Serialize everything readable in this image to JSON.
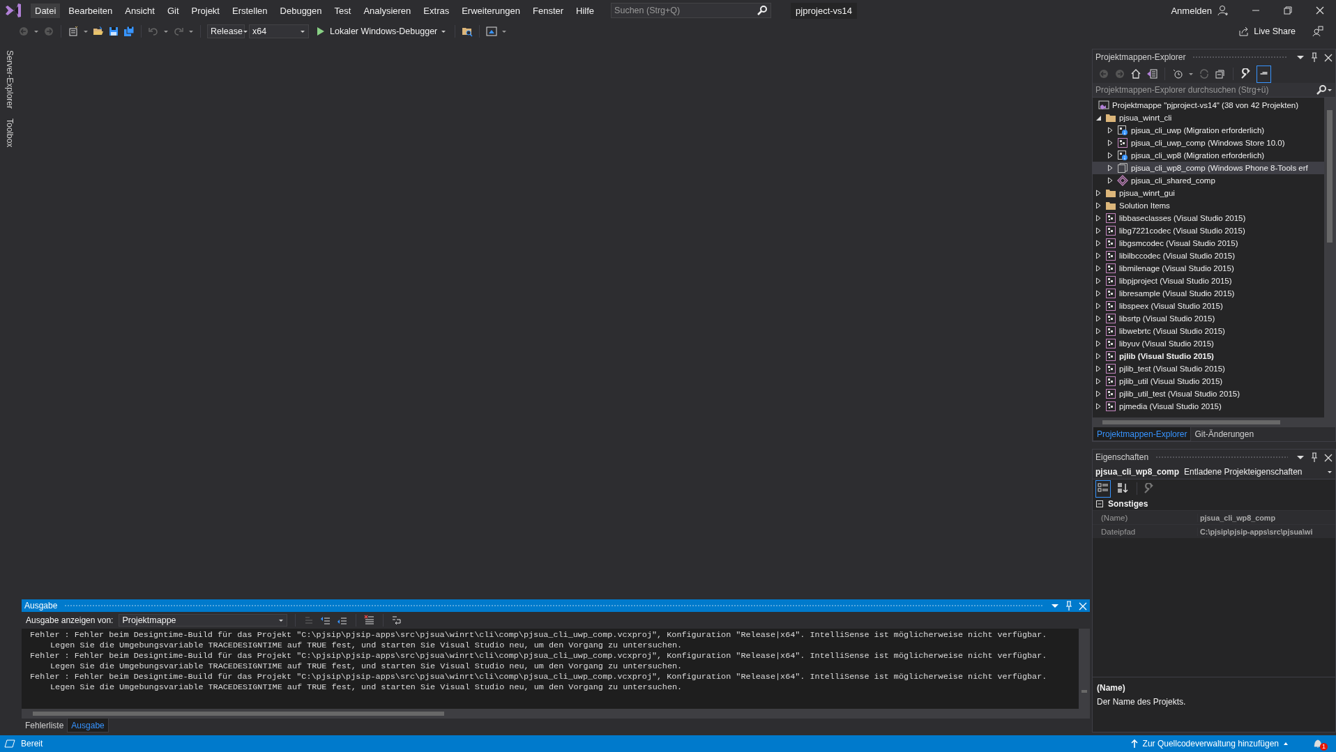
{
  "menu": [
    {
      "label": "Datei",
      "selected": true
    },
    {
      "label": "Bearbeiten",
      "selected": false
    },
    {
      "label": "Ansicht",
      "selected": false
    },
    {
      "label": "Git",
      "selected": false
    },
    {
      "label": "Projekt",
      "selected": false
    },
    {
      "label": "Erstellen",
      "selected": false
    },
    {
      "label": "Debuggen",
      "selected": false
    },
    {
      "label": "Test",
      "selected": false
    },
    {
      "label": "Analysieren",
      "selected": false
    },
    {
      "label": "Extras",
      "selected": false
    },
    {
      "label": "Erweiterungen",
      "selected": false
    },
    {
      "label": "Fenster",
      "selected": false
    },
    {
      "label": "Hilfe",
      "selected": false
    }
  ],
  "search": {
    "placeholder": "Suchen (Strg+Q)"
  },
  "solution_name": "pjproject-vs14",
  "account": "Anmelden",
  "toolbar": {
    "configuration": "Release",
    "platform": "x64",
    "debugger": "Lokaler Windows-Debugger",
    "live_share": "Live Share"
  },
  "side_tabs": [
    "Server-Explorer",
    "Toolbox"
  ],
  "solution_explorer": {
    "title": "Projektmappen-Explorer",
    "preview_selected": true,
    "search": {
      "placeholder": "Projektmappen-Explorer durchsuchen (Strg+ü)"
    },
    "tree": [
      {
        "label": "Projektmappe \"pjproject-vs14\" (38 von 42 Projekten)",
        "kind": "solution",
        "selected": false,
        "startup": false,
        "children": [
          {
            "label": "pjsua_winrt_cli",
            "kind": "folder",
            "expanded": true,
            "selected": false,
            "startup": false,
            "children": [
              {
                "label": "pjsua_cli_uwp (Migration erforderlich)",
                "kind": "migration",
                "expanded": false,
                "selected": false,
                "startup": false
              },
              {
                "label": "pjsua_cli_uwp_comp (Windows Store 10.0)",
                "kind": "project",
                "expanded": false,
                "selected": false,
                "startup": false
              },
              {
                "label": "pjsua_cli_wp8 (Migration erforderlich)",
                "kind": "migration",
                "expanded": false,
                "selected": false,
                "startup": false
              },
              {
                "label": "pjsua_cli_wp8_comp (Windows Phone 8-Tools erf",
                "kind": "unloaded",
                "expanded": false,
                "selected": true,
                "startup": false
              },
              {
                "label": "pjsua_cli_shared_comp",
                "kind": "shared",
                "expanded": false,
                "selected": false,
                "startup": false
              }
            ]
          },
          {
            "label": "pjsua_winrt_gui",
            "kind": "folder",
            "expanded": false,
            "selected": false,
            "startup": false
          },
          {
            "label": "Solution Items",
            "kind": "folder",
            "expanded": false,
            "selected": false,
            "startup": false
          },
          {
            "label": "libbaseclasses (Visual Studio 2015)",
            "kind": "project",
            "expanded": false,
            "selected": false,
            "startup": false
          },
          {
            "label": "libg7221codec (Visual Studio 2015)",
            "kind": "project",
            "expanded": false,
            "selected": false,
            "startup": false
          },
          {
            "label": "libgsmcodec (Visual Studio 2015)",
            "kind": "project",
            "expanded": false,
            "selected": false,
            "startup": false
          },
          {
            "label": "libilbccodec (Visual Studio 2015)",
            "kind": "project",
            "expanded": false,
            "selected": false,
            "startup": false
          },
          {
            "label": "libmilenage (Visual Studio 2015)",
            "kind": "project",
            "expanded": false,
            "selected": false,
            "startup": false
          },
          {
            "label": "libpjproject (Visual Studio 2015)",
            "kind": "project",
            "expanded": false,
            "selected": false,
            "startup": false
          },
          {
            "label": "libresample (Visual Studio 2015)",
            "kind": "project",
            "expanded": false,
            "selected": false,
            "startup": false
          },
          {
            "label": "libspeex (Visual Studio 2015)",
            "kind": "project",
            "expanded": false,
            "selected": false,
            "startup": false
          },
          {
            "label": "libsrtp (Visual Studio 2015)",
            "kind": "project",
            "expanded": false,
            "selected": false,
            "startup": false
          },
          {
            "label": "libwebrtc (Visual Studio 2015)",
            "kind": "project",
            "expanded": false,
            "selected": false,
            "startup": false
          },
          {
            "label": "libyuv (Visual Studio 2015)",
            "kind": "project",
            "expanded": false,
            "selected": false,
            "startup": false
          },
          {
            "label": "pjlib (Visual Studio 2015)",
            "kind": "project",
            "expanded": false,
            "selected": false,
            "startup": true
          },
          {
            "label": "pjlib_test (Visual Studio 2015)",
            "kind": "project",
            "expanded": false,
            "selected": false,
            "startup": false
          },
          {
            "label": "pjlib_util (Visual Studio 2015)",
            "kind": "project",
            "expanded": false,
            "selected": false,
            "startup": false
          },
          {
            "label": "pjlib_util_test (Visual Studio 2015)",
            "kind": "project",
            "expanded": false,
            "selected": false,
            "startup": false
          },
          {
            "label": "pjmedia (Visual Studio 2015)",
            "kind": "project",
            "expanded": false,
            "selected": false,
            "startup": false
          }
        ]
      }
    ],
    "tabs": [
      {
        "label": "Projektmappen-Explorer",
        "selected": true
      },
      {
        "label": "Git-Änderungen",
        "selected": false
      }
    ]
  },
  "properties": {
    "title": "Eigenschaften",
    "object_name": "pjsua_cli_wp8_comp",
    "object_type": "Entladene Projekteigenschaften",
    "view_buttons": [
      {
        "kind": "categorized",
        "selected": true
      },
      {
        "kind": "alphabetical",
        "selected": false
      }
    ],
    "category": {
      "label": "Sonstiges",
      "expanded": true
    },
    "rows": [
      {
        "name": "(Name)",
        "value": "pjsua_cli_wp8_comp"
      },
      {
        "name": "Dateipfad",
        "value": "C:\\pjsip\\pjsip-apps\\src\\pjsua\\wi"
      }
    ],
    "description": {
      "title": "(Name)",
      "text": "Der Name des Projekts."
    }
  },
  "output": {
    "title": "Ausgabe",
    "source_label": "Ausgabe anzeigen von:",
    "source": "Projektmappe",
    "lines": [
      {
        "kind": "error",
        "text": "Fehler : Fehler beim Designtime-Build für das Projekt \"C:\\pjsip\\pjsip-apps\\src\\pjsua\\winrt\\cli\\comp\\pjsua_cli_uwp_comp.vcxproj\", Konfiguration \"Release|x64\". IntelliSense ist möglicherweise nicht verfügbar."
      },
      {
        "kind": "detail",
        "text": "Legen Sie die Umgebungsvariable TRACEDESIGNTIME auf TRUE fest, und starten Sie Visual Studio neu, um den Vorgang zu untersuchen."
      },
      {
        "kind": "error",
        "text": "Fehler : Fehler beim Designtime-Build für das Projekt \"C:\\pjsip\\pjsip-apps\\src\\pjsua\\winrt\\cli\\comp\\pjsua_cli_uwp_comp.vcxproj\", Konfiguration \"Release|x64\". IntelliSense ist möglicherweise nicht verfügbar."
      },
      {
        "kind": "detail",
        "text": "Legen Sie die Umgebungsvariable TRACEDESIGNTIME auf TRUE fest, und starten Sie Visual Studio neu, um den Vorgang zu untersuchen."
      },
      {
        "kind": "error",
        "text": "Fehler : Fehler beim Designtime-Build für das Projekt \"C:\\pjsip\\pjsip-apps\\src\\pjsua\\winrt\\cli\\comp\\pjsua_cli_uwp_comp.vcxproj\", Konfiguration \"Release|x64\". IntelliSense ist möglicherweise nicht verfügbar."
      },
      {
        "kind": "detail",
        "text": "Legen Sie die Umgebungsvariable TRACEDESIGNTIME auf TRUE fest, und starten Sie Visual Studio neu, um den Vorgang zu untersuchen."
      }
    ],
    "tabs": [
      {
        "label": "Fehlerliste",
        "selected": false
      },
      {
        "label": "Ausgabe",
        "selected": true
      }
    ]
  },
  "status_bar": {
    "text": "Bereit",
    "source_control": "Zur Quellcodeverwaltung hinzufügen",
    "notifications": "1"
  }
}
